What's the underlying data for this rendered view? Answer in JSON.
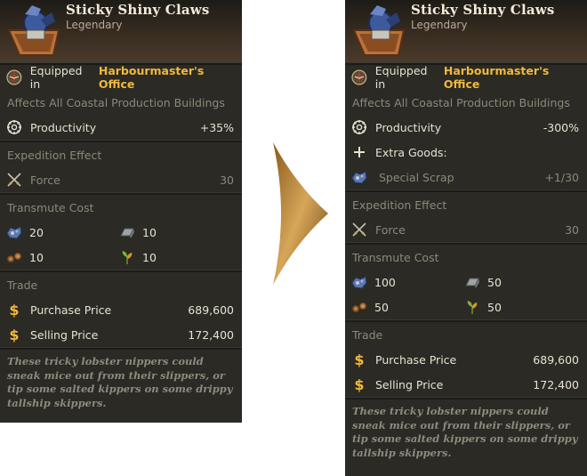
{
  "colors": {
    "panel": "#2b2a24",
    "gold": "#f0b83c",
    "dim": "#8e887a"
  },
  "left": {
    "title": "Sticky Shiny Claws",
    "rarity": "Legendary",
    "equipped_prefix": "Equipped in",
    "equipped_place": "Harbourmaster's Office",
    "affects": "Affects All Coastal Production Buildings",
    "productivity_label": "Productivity",
    "productivity_value": "+35%",
    "expedition_header": "Expedition Effect",
    "force_label": "Force",
    "force_value": "30",
    "transmute_header": "Transmute Cost",
    "cost": {
      "scrap": "20",
      "ingot": "10",
      "wood": "10",
      "plant": "10"
    },
    "trade_header": "Trade",
    "purchase_label": "Purchase Price",
    "purchase_value": "689,600",
    "selling_label": "Selling Price",
    "selling_value": "172,400",
    "flavor": "These tricky lobster nippers could sneak mice out from their slippers, or tip some salted kippers on some drippy tallship skippers."
  },
  "right": {
    "title": "Sticky Shiny Claws",
    "rarity": "Legendary",
    "equipped_prefix": "Equipped in",
    "equipped_place": "Harbourmaster's Office",
    "affects": "Affects All Coastal Production Buildings",
    "productivity_label": "Productivity",
    "productivity_value": "-300%",
    "extra_goods_label": "Extra Goods:",
    "special_scrap_label": "Special Scrap",
    "special_scrap_value": "+1/30",
    "expedition_header": "Expedition Effect",
    "force_label": "Force",
    "force_value": "30",
    "transmute_header": "Transmute Cost",
    "cost": {
      "scrap": "100",
      "ingot": "50",
      "wood": "50",
      "plant": "50"
    },
    "trade_header": "Trade",
    "purchase_label": "Purchase Price",
    "purchase_value": "689,600",
    "selling_label": "Selling Price",
    "selling_value": "172,400",
    "flavor": "These tricky lobster nippers could sneak mice out from their slippers, or tip some salted kippers on some drippy tallship skippers."
  },
  "icons": [
    "claw-item-icon",
    "equipped-medal-icon",
    "productivity-gear-icon",
    "plus-icon",
    "special-scrap-icon",
    "crossed-swords-icon",
    "scrap-icon",
    "iron-ingot-icon",
    "wood-logs-icon",
    "plant-icon",
    "dollar-icon",
    "arrow-icon"
  ]
}
